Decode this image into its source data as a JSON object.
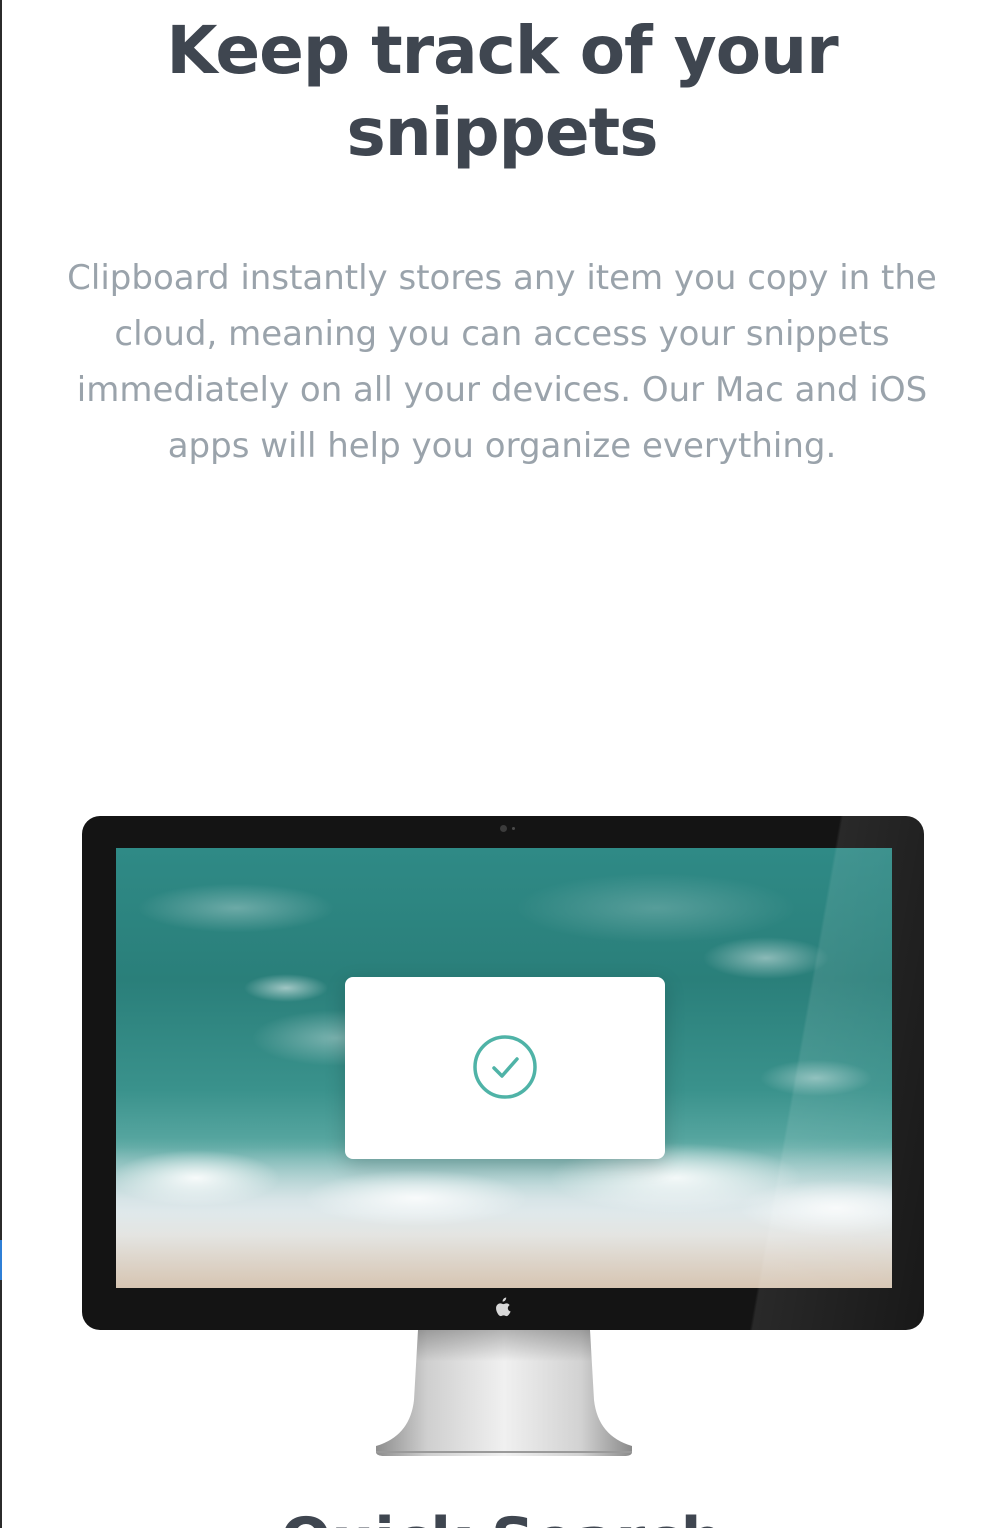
{
  "hero": {
    "title": "Keep track of your snippets",
    "description": "Clipboard instantly stores any item you copy in the cloud, meaning you can access your snippets immediately on all your devices. Our Mac and iOS apps will help you organize everything."
  },
  "next_section": {
    "title": "Quick Search"
  },
  "icons": {
    "dialog": "check-circle-icon",
    "monitor_logo": "apple-logo-icon"
  },
  "colors": {
    "heading": "#3f4650",
    "body_text": "#9aa3ab",
    "accent": "#4fb3a7",
    "monitor_bezel": "#141414"
  }
}
